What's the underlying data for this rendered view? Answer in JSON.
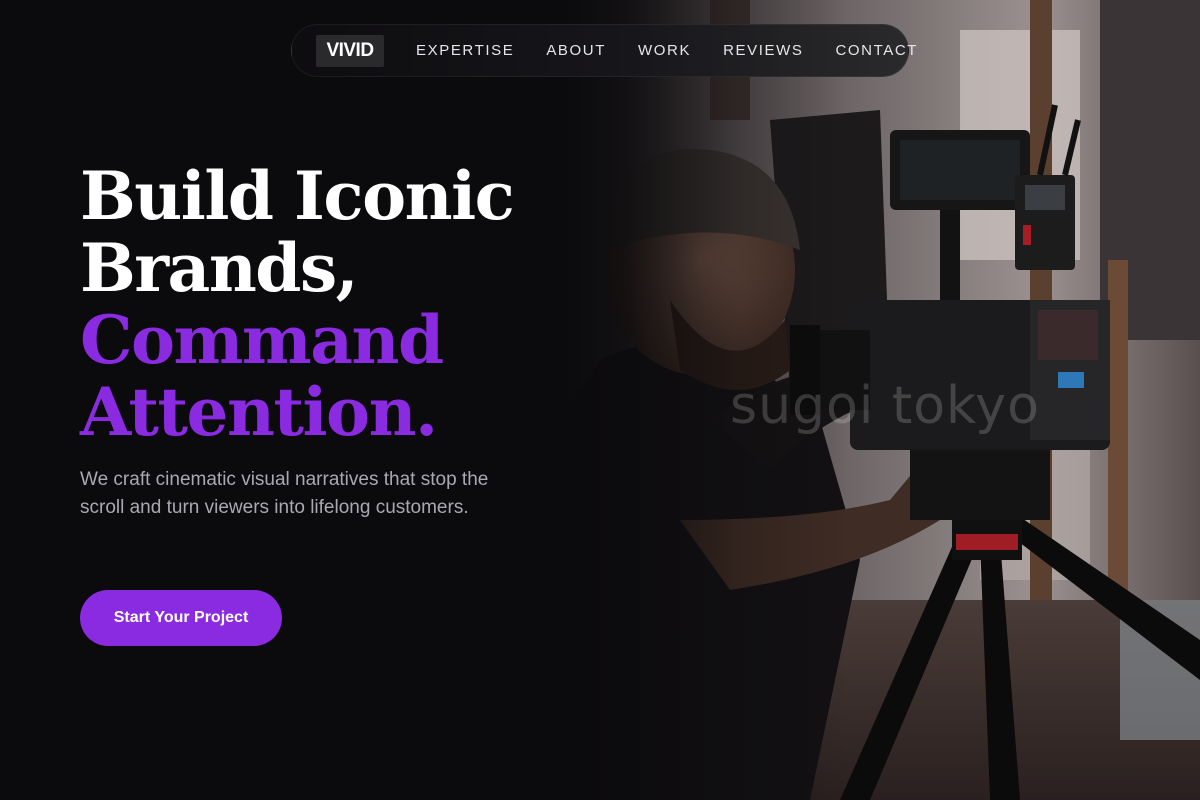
{
  "brand": {
    "logo_text": "VIVID"
  },
  "nav": {
    "links": [
      {
        "label": "EXPERTISE"
      },
      {
        "label": "ABOUT"
      },
      {
        "label": "WORK"
      },
      {
        "label": "REVIEWS"
      },
      {
        "label": "CONTACT"
      }
    ]
  },
  "hero": {
    "headline_lines": [
      {
        "text": "Build Iconic",
        "color": "#ffffff"
      },
      {
        "text": "Brands,",
        "color": "#ffffff"
      },
      {
        "text": "Command",
        "color": "#8a2be2"
      },
      {
        "text": "Attention.",
        "color": "#8a2be2"
      }
    ],
    "subtitle": "We craft cinematic visual narratives that stop the scroll and turn viewers into lifelong customers.",
    "cta_label": "Start Your Project",
    "image_watermark": "sugoi tokyo"
  },
  "colors": {
    "accent": "#8a2be2",
    "background": "#0b0a0c",
    "text_primary": "#ffffff",
    "text_muted": "#a9a9b2"
  }
}
